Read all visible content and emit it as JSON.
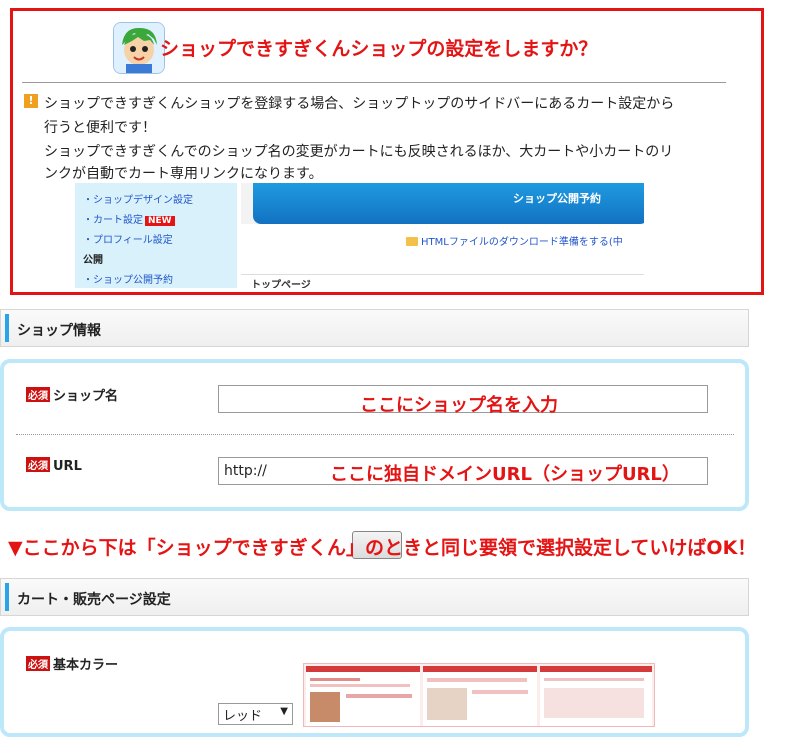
{
  "notice": {
    "title": "ショップできすぎくんショップの設定をしますか？",
    "warning_icon_glyph": "!",
    "line1": "ショップできすぎくんショップを登録する場合、ショップトップのサイドバーにあるカート設定から",
    "line2": "行うと便利です！",
    "line3": "ショップできすぎくんでのショップ名の変更がカートにも反映されるほか、大カートや小カートのリ",
    "line4": "ンクが自動でカート専用リンクになります。",
    "mini": {
      "side_items": [
        "ショップデザイン設定",
        "カート設定",
        "プロフィール設定"
      ],
      "new_badge": "NEW",
      "section_public": "公開",
      "side_item_reserve": "ショップ公開予約",
      "top_bar_label": "ショップ公開予約",
      "download_link": "HTMLファイルのダウンロード準備をする(中",
      "top_page": "トップページ"
    }
  },
  "shop_info": {
    "header": "ショップ情報",
    "required_label": "必須",
    "shop_name_label": "ショップ名",
    "shop_name_hint": "ここにショップ名を入力",
    "url_label": "URL",
    "url_value": "http://",
    "url_hint": "ここに独自ドメインURL（ショップURL）"
  },
  "banner": "▼ここから下は「ショップできすぎくん」のときと同じ要領で選択設定していけばOK！",
  "cart_settings": {
    "header": "カート・販売ページ設定",
    "required_label": "必須",
    "base_color_label": "基本カラー",
    "base_color_value": "レッド"
  },
  "colors": {
    "alert_red": "#e41414",
    "accent_blue": "#2aa4e8",
    "panel_border": "#bde8fa"
  }
}
